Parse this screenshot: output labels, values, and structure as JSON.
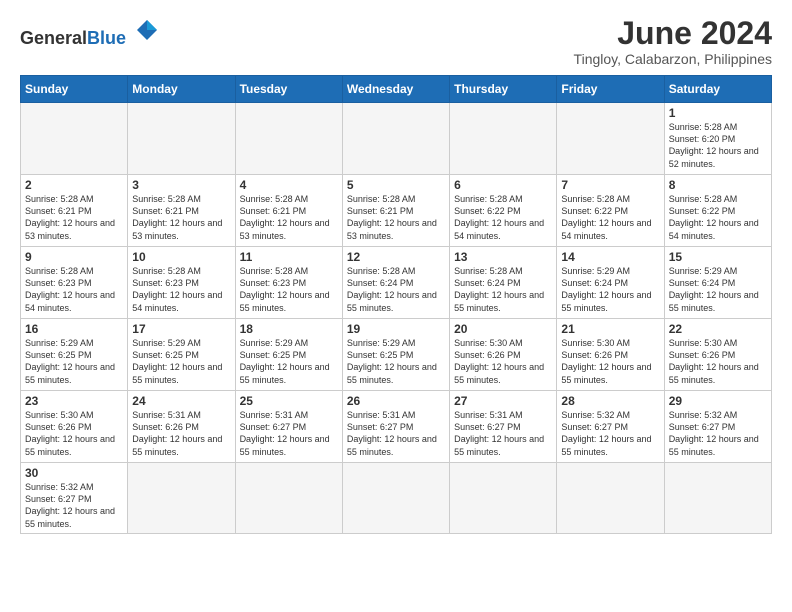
{
  "header": {
    "logo_general": "General",
    "logo_blue": "Blue",
    "month_title": "June 2024",
    "location": "Tingloy, Calabarzon, Philippines"
  },
  "weekdays": [
    "Sunday",
    "Monday",
    "Tuesday",
    "Wednesday",
    "Thursday",
    "Friday",
    "Saturday"
  ],
  "weeks": [
    [
      {
        "day": "",
        "empty": true
      },
      {
        "day": "",
        "empty": true
      },
      {
        "day": "",
        "empty": true
      },
      {
        "day": "",
        "empty": true
      },
      {
        "day": "",
        "empty": true
      },
      {
        "day": "",
        "empty": true
      },
      {
        "day": "1",
        "sunrise": "5:28 AM",
        "sunset": "6:20 PM",
        "daylight": "12 hours and 52 minutes."
      }
    ],
    [
      {
        "day": "2",
        "sunrise": "5:28 AM",
        "sunset": "6:21 PM",
        "daylight": "12 hours and 53 minutes."
      },
      {
        "day": "3",
        "sunrise": "5:28 AM",
        "sunset": "6:21 PM",
        "daylight": "12 hours and 53 minutes."
      },
      {
        "day": "4",
        "sunrise": "5:28 AM",
        "sunset": "6:21 PM",
        "daylight": "12 hours and 53 minutes."
      },
      {
        "day": "5",
        "sunrise": "5:28 AM",
        "sunset": "6:21 PM",
        "daylight": "12 hours and 53 minutes."
      },
      {
        "day": "6",
        "sunrise": "5:28 AM",
        "sunset": "6:22 PM",
        "daylight": "12 hours and 54 minutes."
      },
      {
        "day": "7",
        "sunrise": "5:28 AM",
        "sunset": "6:22 PM",
        "daylight": "12 hours and 54 minutes."
      },
      {
        "day": "8",
        "sunrise": "5:28 AM",
        "sunset": "6:22 PM",
        "daylight": "12 hours and 54 minutes."
      }
    ],
    [
      {
        "day": "9",
        "sunrise": "5:28 AM",
        "sunset": "6:23 PM",
        "daylight": "12 hours and 54 minutes."
      },
      {
        "day": "10",
        "sunrise": "5:28 AM",
        "sunset": "6:23 PM",
        "daylight": "12 hours and 54 minutes."
      },
      {
        "day": "11",
        "sunrise": "5:28 AM",
        "sunset": "6:23 PM",
        "daylight": "12 hours and 55 minutes."
      },
      {
        "day": "12",
        "sunrise": "5:28 AM",
        "sunset": "6:24 PM",
        "daylight": "12 hours and 55 minutes."
      },
      {
        "day": "13",
        "sunrise": "5:28 AM",
        "sunset": "6:24 PM",
        "daylight": "12 hours and 55 minutes."
      },
      {
        "day": "14",
        "sunrise": "5:29 AM",
        "sunset": "6:24 PM",
        "daylight": "12 hours and 55 minutes."
      },
      {
        "day": "15",
        "sunrise": "5:29 AM",
        "sunset": "6:24 PM",
        "daylight": "12 hours and 55 minutes."
      }
    ],
    [
      {
        "day": "16",
        "sunrise": "5:29 AM",
        "sunset": "6:25 PM",
        "daylight": "12 hours and 55 minutes."
      },
      {
        "day": "17",
        "sunrise": "5:29 AM",
        "sunset": "6:25 PM",
        "daylight": "12 hours and 55 minutes."
      },
      {
        "day": "18",
        "sunrise": "5:29 AM",
        "sunset": "6:25 PM",
        "daylight": "12 hours and 55 minutes."
      },
      {
        "day": "19",
        "sunrise": "5:29 AM",
        "sunset": "6:25 PM",
        "daylight": "12 hours and 55 minutes."
      },
      {
        "day": "20",
        "sunrise": "5:30 AM",
        "sunset": "6:26 PM",
        "daylight": "12 hours and 55 minutes."
      },
      {
        "day": "21",
        "sunrise": "5:30 AM",
        "sunset": "6:26 PM",
        "daylight": "12 hours and 55 minutes."
      },
      {
        "day": "22",
        "sunrise": "5:30 AM",
        "sunset": "6:26 PM",
        "daylight": "12 hours and 55 minutes."
      }
    ],
    [
      {
        "day": "23",
        "sunrise": "5:30 AM",
        "sunset": "6:26 PM",
        "daylight": "12 hours and 55 minutes."
      },
      {
        "day": "24",
        "sunrise": "5:31 AM",
        "sunset": "6:26 PM",
        "daylight": "12 hours and 55 minutes."
      },
      {
        "day": "25",
        "sunrise": "5:31 AM",
        "sunset": "6:27 PM",
        "daylight": "12 hours and 55 minutes."
      },
      {
        "day": "26",
        "sunrise": "5:31 AM",
        "sunset": "6:27 PM",
        "daylight": "12 hours and 55 minutes."
      },
      {
        "day": "27",
        "sunrise": "5:31 AM",
        "sunset": "6:27 PM",
        "daylight": "12 hours and 55 minutes."
      },
      {
        "day": "28",
        "sunrise": "5:32 AM",
        "sunset": "6:27 PM",
        "daylight": "12 hours and 55 minutes."
      },
      {
        "day": "29",
        "sunrise": "5:32 AM",
        "sunset": "6:27 PM",
        "daylight": "12 hours and 55 minutes."
      }
    ],
    [
      {
        "day": "30",
        "sunrise": "5:32 AM",
        "sunset": "6:27 PM",
        "daylight": "12 hours and 55 minutes."
      },
      {
        "day": "",
        "empty": true
      },
      {
        "day": "",
        "empty": true
      },
      {
        "day": "",
        "empty": true
      },
      {
        "day": "",
        "empty": true
      },
      {
        "day": "",
        "empty": true
      },
      {
        "day": "",
        "empty": true
      }
    ]
  ]
}
